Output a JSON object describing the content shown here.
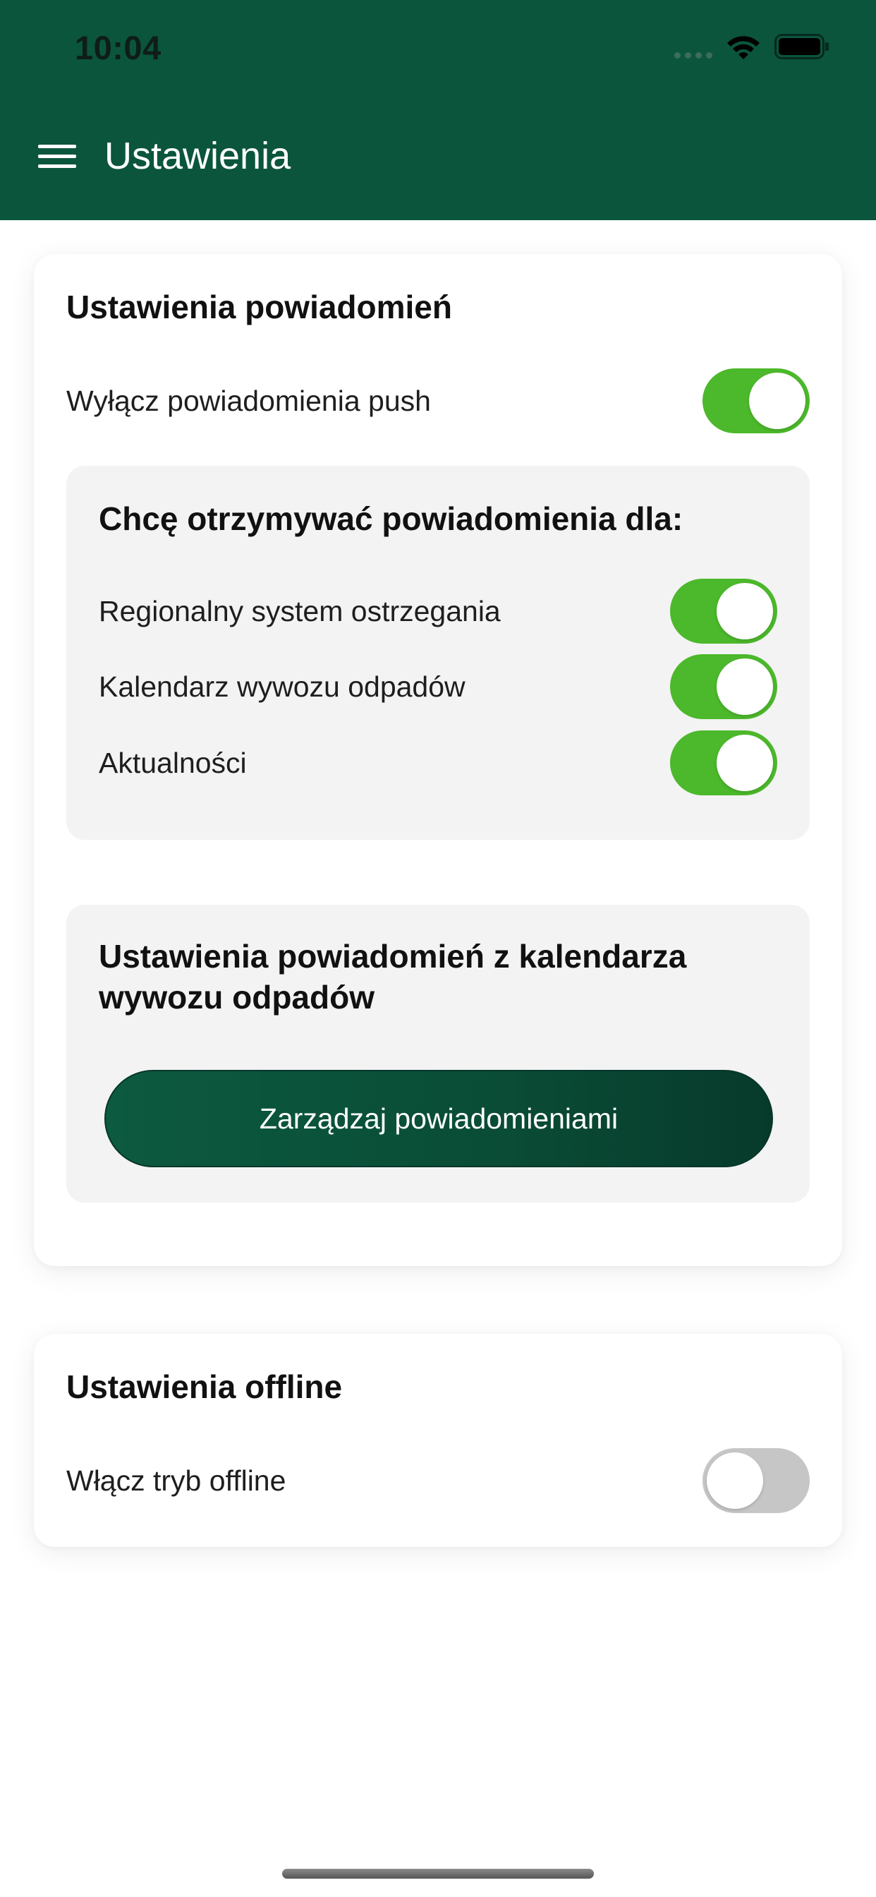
{
  "status_bar": {
    "time": "10:04"
  },
  "header": {
    "title": "Ustawienia",
    "menu_icon": "hamburger-menu-icon",
    "background_color": "#0b553d"
  },
  "notification_settings": {
    "title": "Ustawienia powiadomień",
    "push_toggle": {
      "label": "Wyłącz powiadomienia push",
      "checked": true
    },
    "categories": {
      "title": "Chcę otrzymywać powiadomienia dla:",
      "items": [
        {
          "label": "Regionalny system ostrzegania",
          "checked": true
        },
        {
          "label": "Kalendarz wywozu odpadów",
          "checked": true
        },
        {
          "label": "Aktualności",
          "checked": true
        }
      ]
    },
    "waste_calendar": {
      "title": "Ustawienia powiadomień z kalendarza wywozu odpadów",
      "button_label": "Zarządzaj powiadomieniami"
    }
  },
  "offline_settings": {
    "title": "Ustawienia offline",
    "offline_toggle": {
      "label": "Włącz tryb offline",
      "checked": false
    }
  },
  "colors": {
    "toggle_on": "#4cb82b",
    "toggle_off": "#c6c6c6",
    "panel_background": "#f3f3f3",
    "button_background": "#0a4c36"
  }
}
